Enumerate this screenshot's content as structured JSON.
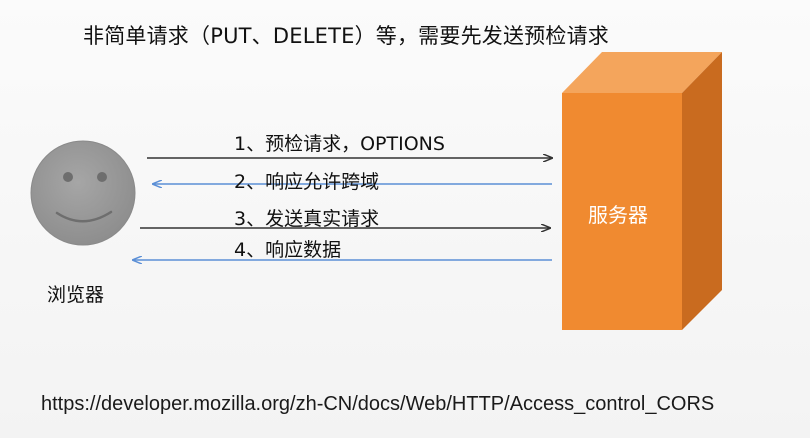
{
  "title": "非简单请求（PUT、DELETE）等，需要先发送预检请求",
  "browser": {
    "label": "浏览器",
    "face_color": "#999999"
  },
  "server": {
    "label": "服务器",
    "front_color": "#f08a30",
    "top_color": "#f3a35a",
    "side_color": "#c86a1e"
  },
  "messages": [
    {
      "label": "1、预检请求，OPTIONS",
      "direction": "to-server",
      "color": "#333333"
    },
    {
      "label": "2、响应允许跨域",
      "direction": "to-browser",
      "color": "#5b8fd6"
    },
    {
      "label": "3、发送真实请求",
      "direction": "to-server",
      "color": "#333333"
    },
    {
      "label": "4、响应数据",
      "direction": "to-browser",
      "color": "#5b8fd6"
    }
  ],
  "reference_url": "https://developer.mozilla.org/zh-CN/docs/Web/HTTP/Access_control_CORS"
}
